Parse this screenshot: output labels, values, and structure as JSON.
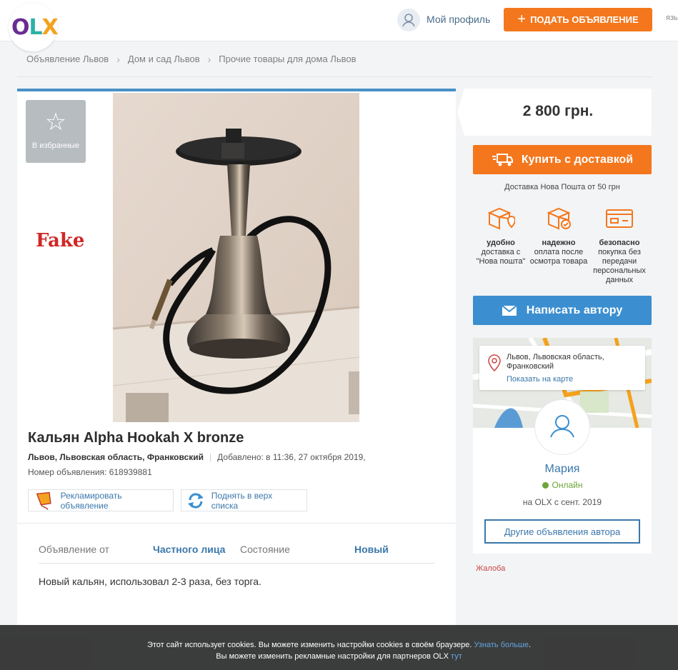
{
  "header": {
    "logo": "OLX",
    "profile_label": "Мой профиль",
    "post_ad_label": "ПОДАТЬ ОБЪЯВЛЕНИЕ",
    "lang": "язы"
  },
  "breadcrumb": [
    "Объявление Львов",
    "Дом и сад Львов",
    "Прочие товары для дома Львов"
  ],
  "listing": {
    "favorite_label": "В избранные",
    "watermark": "Fake",
    "title": "Кальян Alpha Hookah X bronze",
    "location": "Львов, Львовская область, Франковский",
    "added": "Добавлено: в 11:36, 27 октября 2019,",
    "ad_number": "Номер объявления: 618939881",
    "promote_label": "Рекламировать объявление",
    "bump_label": "Поднять в верх списка",
    "params": {
      "from_label": "Объявление от",
      "from_value": "Частного лица",
      "condition_label": "Состояние",
      "condition_value": "Новый"
    },
    "description": "Новый кальян, использовал 2-3 раза, без торга."
  },
  "sidebar": {
    "price": "2 800 грн.",
    "buy_label": "Купить с доставкой",
    "delivery_note": "Доставка Нова Пошта от 50 грн",
    "features": [
      {
        "title": "удобно",
        "text": "доставка с \"Нова пошта\""
      },
      {
        "title": "надежно",
        "text": "оплата после осмотра товара"
      },
      {
        "title": "безопасно",
        "text": "покупка без передачи персональных данных"
      }
    ],
    "write_label": "Написать автору",
    "location_text": "Львов, Львовская область, Франковский",
    "show_on_map": "Показать на карте",
    "seller_name": "Мария",
    "online": "Онлайн",
    "since": "на OLX с сент. 2019",
    "other_ads": "Другие объявления автора",
    "complaint": "Жалоба"
  },
  "cookie": {
    "line1": "Этот сайт использует cookies. Вы можете изменить настройки cookies в своём браузере.",
    "link1": "Узнать больше",
    "line2": "Вы можете изменить рекламные настройки для партнеров OLX",
    "link2": "тут"
  },
  "colors": {
    "accent_orange": "#f4771d",
    "accent_blue": "#3b8fd0",
    "link": "#3a77aa",
    "online": "#6ba539"
  }
}
